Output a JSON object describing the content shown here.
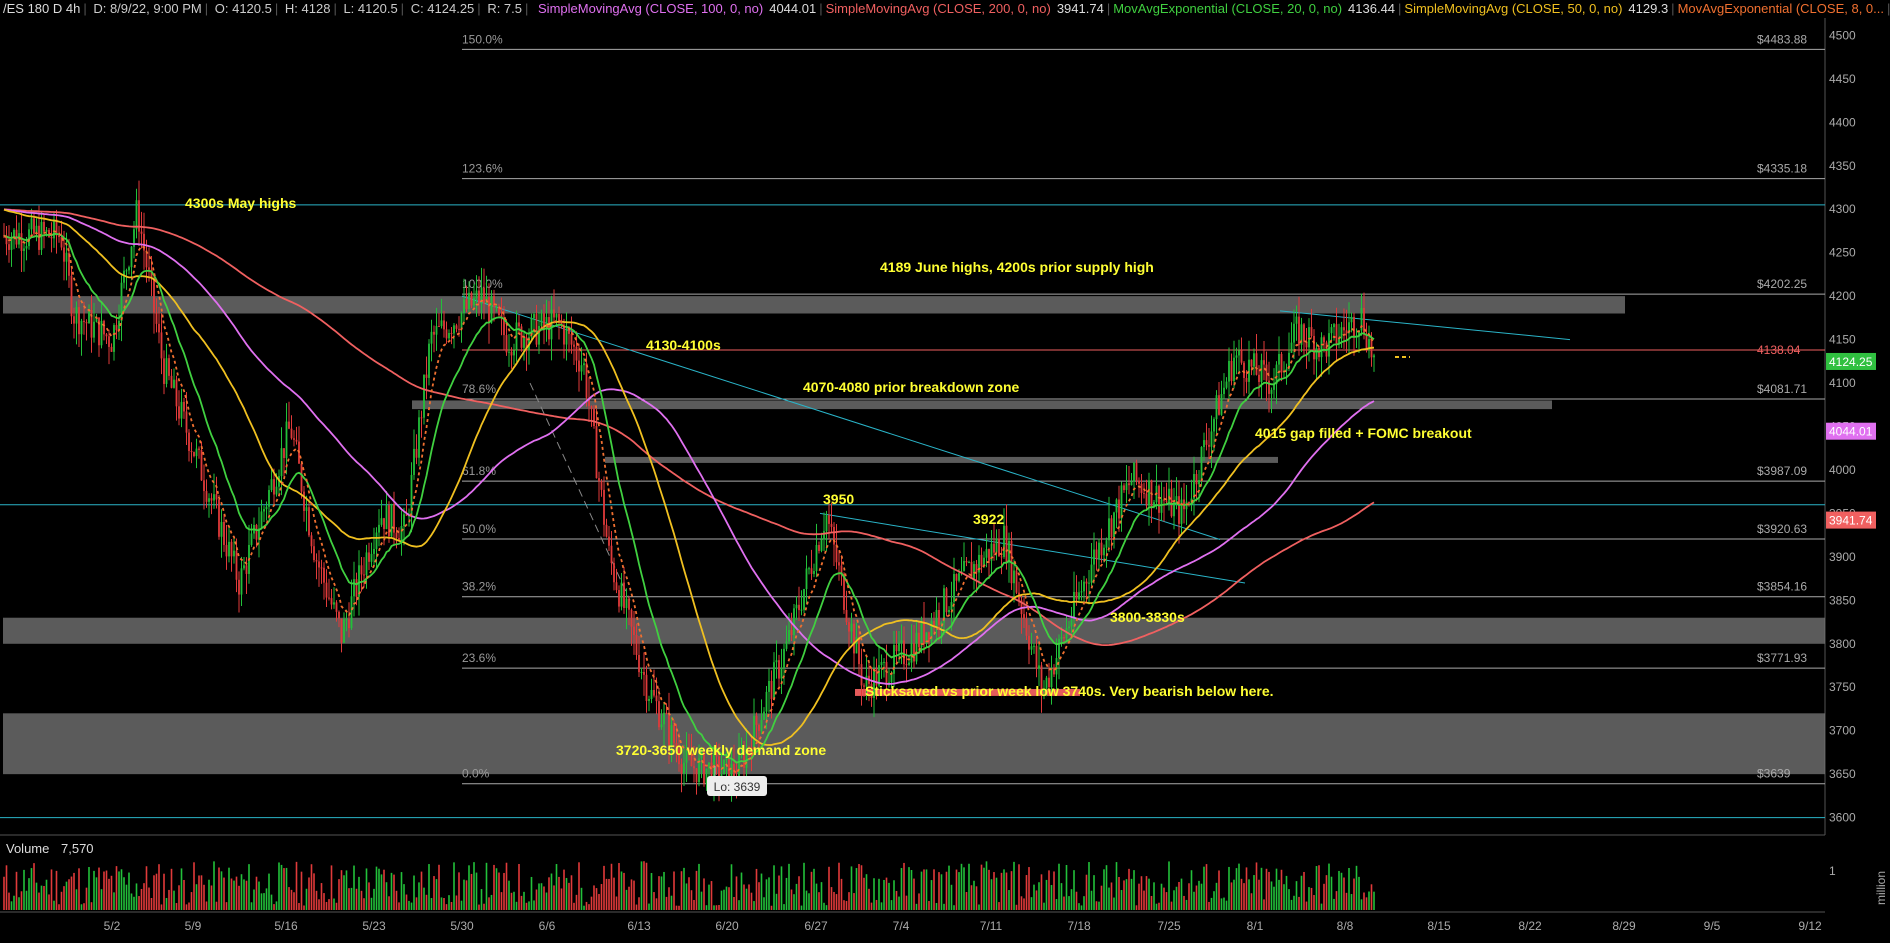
{
  "header": {
    "symbol": "/ES 180 D 4h",
    "datetime": "D: 8/9/22, 9:00 PM",
    "open": "O: 4120.5",
    "high": "H: 4128",
    "low": "L: 4120.5",
    "close": "C: 4124.25",
    "range": "R: 7.5",
    "studies": [
      {
        "label": "SimpleMovingAvg (CLOSE, 100, 0, no)",
        "value": "4044.01",
        "color": "#e070f0"
      },
      {
        "label": "SimpleMovingAvg (CLOSE, 200, 0, no)",
        "value": "3941.74",
        "color": "#f06060"
      },
      {
        "label": "MovAvgExponential (CLOSE, 20, 0, no)",
        "value": "4136.44",
        "color": "#40d040"
      },
      {
        "label": "SimpleMovingAvg (CLOSE, 50, 0, no)",
        "value": "4129.3",
        "color": "#f0c020"
      },
      {
        "label": "MovAvgExponential (CLOSE, 8, 0...",
        "value": "",
        "color": "#f07030"
      }
    ]
  },
  "chart_data": {
    "type": "candlestick",
    "symbol": "/ES",
    "timeframe": "4h",
    "ylim": [
      3580,
      4520
    ],
    "yticks": [
      3600,
      3650,
      3700,
      3750,
      3800,
      3850,
      3900,
      3950,
      4000,
      4050,
      4100,
      4150,
      4200,
      4250,
      4300,
      4350,
      4400,
      4450,
      4500
    ],
    "xticks": [
      "5/2",
      "5/9",
      "5/16",
      "5/23",
      "5/30",
      "6/6",
      "6/13",
      "6/20",
      "6/27",
      "7/4",
      "7/11",
      "7/18",
      "7/25",
      "8/1",
      "8/8",
      "8/15",
      "8/22",
      "8/29",
      "9/5",
      "9/12"
    ],
    "price_path": [
      [
        "4/28",
        4270
      ],
      [
        "4/29",
        4180
      ],
      [
        "5/2",
        4150
      ],
      [
        "5/4",
        4300
      ],
      [
        "5/6",
        4120
      ],
      [
        "5/9",
        4000
      ],
      [
        "5/12",
        3870
      ],
      [
        "5/16",
        4050
      ],
      [
        "5/18",
        3900
      ],
      [
        "5/20",
        3810
      ],
      [
        "5/23",
        3950
      ],
      [
        "5/25",
        3930
      ],
      [
        "5/27",
        4150
      ],
      [
        "5/31",
        4200
      ],
      [
        "6/2",
        4150
      ],
      [
        "6/6",
        4170
      ],
      [
        "6/8",
        4120
      ],
      [
        "6/10",
        3900
      ],
      [
        "6/13",
        3750
      ],
      [
        "6/16",
        3660
      ],
      [
        "6/20",
        3650
      ],
      [
        "6/24",
        3800
      ],
      [
        "6/27",
        3950
      ],
      [
        "6/30",
        3750
      ],
      [
        "7/4",
        3800
      ],
      [
        "7/8",
        3880
      ],
      [
        "7/11",
        3922
      ],
      [
        "7/14",
        3745
      ],
      [
        "7/18",
        3900
      ],
      [
        "7/21",
        3990
      ],
      [
        "7/25",
        3950
      ],
      [
        "7/27",
        4040
      ],
      [
        "7/29",
        4130
      ],
      [
        "8/1",
        4100
      ],
      [
        "8/3",
        4160
      ],
      [
        "8/5",
        4140
      ],
      [
        "8/8",
        4178
      ],
      [
        "8/9",
        4124
      ]
    ],
    "series": [
      {
        "name": "SimpleMovingAvg (CLOSE, 100, 0, no)",
        "color": "#e070f0",
        "last": 4044.01
      },
      {
        "name": "SimpleMovingAvg (CLOSE, 200, 0, no)",
        "color": "#f06060",
        "last": 3941.74
      },
      {
        "name": "MovAvgExponential (CLOSE, 20, 0, no)",
        "color": "#40d040",
        "last": 4136.44
      },
      {
        "name": "SimpleMovingAvg (CLOSE, 50, 0, no)",
        "color": "#f0c020",
        "last": 4129.3
      },
      {
        "name": "MovAvgExponential (CLOSE, 8, 0...",
        "color": "#f07030"
      }
    ],
    "fib_levels": [
      {
        "ratio": "0.0%",
        "price": 3639,
        "price_label": "$3639"
      },
      {
        "ratio": "23.6%",
        "price": 3771.93,
        "price_label": "$3771.93"
      },
      {
        "ratio": "38.2%",
        "price": 3854.16,
        "price_label": "$3854.16"
      },
      {
        "ratio": "50.0%",
        "price": 3920.63,
        "price_label": "$3920.63"
      },
      {
        "ratio": "61.8%",
        "price": 3987.09,
        "price_label": "$3987.09"
      },
      {
        "ratio": "78.6%",
        "price": 4081.71,
        "price_label": "$4081.71"
      },
      {
        "ratio": "100.0%",
        "price": 4202.25,
        "price_label": "$4202.25"
      },
      {
        "ratio": "123.6%",
        "price": 4335.18,
        "price_label": "$4335.18"
      },
      {
        "ratio": "150.0%",
        "price": 4483.88,
        "price_label": "$4483.88"
      }
    ],
    "zones": [
      {
        "low": 4180,
        "high": 4200
      },
      {
        "low": 4070,
        "high": 4080
      },
      {
        "low": 4010,
        "high": 4015
      },
      {
        "low": 3800,
        "high": 3830
      },
      {
        "low": 3740,
        "high": 3748
      },
      {
        "low": 3650,
        "high": 3720
      }
    ],
    "horizontal_lines": [
      4305,
      3960,
      3600,
      4138.04
    ],
    "price_badges": [
      {
        "value": "4138.04",
        "price": 4138.04,
        "color": "#f06060",
        "style": "text"
      },
      {
        "value": "4124.25",
        "price": 4124.25,
        "color": "#30c040",
        "style": "box"
      },
      {
        "value": "4044.01",
        "price": 4044.01,
        "color": "#e070f0",
        "style": "box"
      },
      {
        "value": "3941.74",
        "price": 3941.74,
        "color": "#f06060",
        "style": "box"
      }
    ],
    "annotations": [
      {
        "text": "4300s May highs"
      },
      {
        "text": "4189 June highs, 4200s prior supply high"
      },
      {
        "text": "4130-4100s"
      },
      {
        "text": "4070-4080 prior breakdown zone"
      },
      {
        "text": "4015 gap filled + FOMC breakout"
      },
      {
        "text": "3950"
      },
      {
        "text": "3922"
      },
      {
        "text": "3800-3830s"
      },
      {
        "text": "Sticksaved vs prior week low 3740s. Very bearish below here."
      },
      {
        "text": "3720-3650 weekly demand zone"
      }
    ],
    "low_label": "Lo: 3639",
    "volume": {
      "label": "Volume",
      "value": "7,570",
      "axis_label": "1",
      "unit_label": "million"
    }
  }
}
